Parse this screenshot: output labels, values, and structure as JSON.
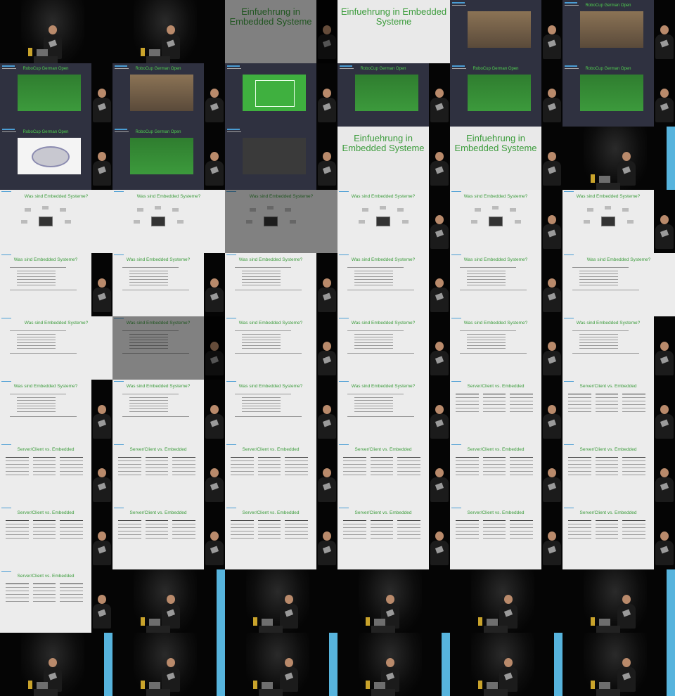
{
  "grid": {
    "columns": 6,
    "rows": 11
  },
  "titles": {
    "einfuehrung": "Einfuehrung in Embedded Systeme",
    "robocup": "RoboCup German Open",
    "was_sind": "Was sind Embedded Systeme?",
    "server_client": "Server/Client vs. Embedded"
  },
  "diagram_labels": {
    "top": "Electronic Components",
    "bottom": "Embedded System"
  },
  "tiles": [
    {
      "type": "stage"
    },
    {
      "type": "stage"
    },
    {
      "type": "title",
      "fade": true
    },
    {
      "type": "title",
      "full": true
    },
    {
      "type": "dark",
      "pic": "robot"
    },
    {
      "type": "dark",
      "pic": "robot",
      "title": "robocup"
    },
    {
      "type": "dark",
      "pic": "field",
      "title": "robocup"
    },
    {
      "type": "dark",
      "pic": "robot",
      "title": "robocup"
    },
    {
      "type": "dark",
      "pic": "pitch"
    },
    {
      "type": "dark",
      "pic": "field",
      "title": "robocup"
    },
    {
      "type": "dark",
      "pic": "field",
      "title": "robocup"
    },
    {
      "type": "dark",
      "pic": "field",
      "title": "robocup"
    },
    {
      "type": "dark",
      "pic": "logo",
      "title": "robocup"
    },
    {
      "type": "dark",
      "pic": "field",
      "title": "robocup"
    },
    {
      "type": "dark",
      "pic": "screenpic"
    },
    {
      "type": "title"
    },
    {
      "type": "title"
    },
    {
      "type": "stage"
    },
    {
      "type": "diagram",
      "full": true
    },
    {
      "type": "diagram",
      "full": true
    },
    {
      "type": "diagram",
      "full": true,
      "fade": true
    },
    {
      "type": "diagram"
    },
    {
      "type": "diagram"
    },
    {
      "type": "diagram"
    },
    {
      "type": "bullets"
    },
    {
      "type": "bullets"
    },
    {
      "type": "bullets"
    },
    {
      "type": "bullets"
    },
    {
      "type": "bullets"
    },
    {
      "type": "bullets",
      "full": true
    },
    {
      "type": "bullets",
      "full": true
    },
    {
      "type": "bullets",
      "fade": true
    },
    {
      "type": "bullets"
    },
    {
      "type": "bullets"
    },
    {
      "type": "bullets"
    },
    {
      "type": "bullets"
    },
    {
      "type": "bullets"
    },
    {
      "type": "bullets"
    },
    {
      "type": "bullets"
    },
    {
      "type": "bullets"
    },
    {
      "type": "table"
    },
    {
      "type": "table"
    },
    {
      "type": "table"
    },
    {
      "type": "table"
    },
    {
      "type": "table"
    },
    {
      "type": "table"
    },
    {
      "type": "table"
    },
    {
      "type": "table"
    },
    {
      "type": "table"
    },
    {
      "type": "table"
    },
    {
      "type": "table"
    },
    {
      "type": "table"
    },
    {
      "type": "table"
    },
    {
      "type": "table"
    },
    {
      "type": "table"
    },
    {
      "type": "stage"
    },
    {
      "type": "stage"
    },
    {
      "type": "stage"
    },
    {
      "type": "stage"
    },
    {
      "type": "stage"
    },
    {
      "type": "stage"
    },
    {
      "type": "stage"
    },
    {
      "type": "stage"
    },
    {
      "type": "stage"
    },
    {
      "type": "stage"
    },
    {
      "type": "stage"
    }
  ]
}
